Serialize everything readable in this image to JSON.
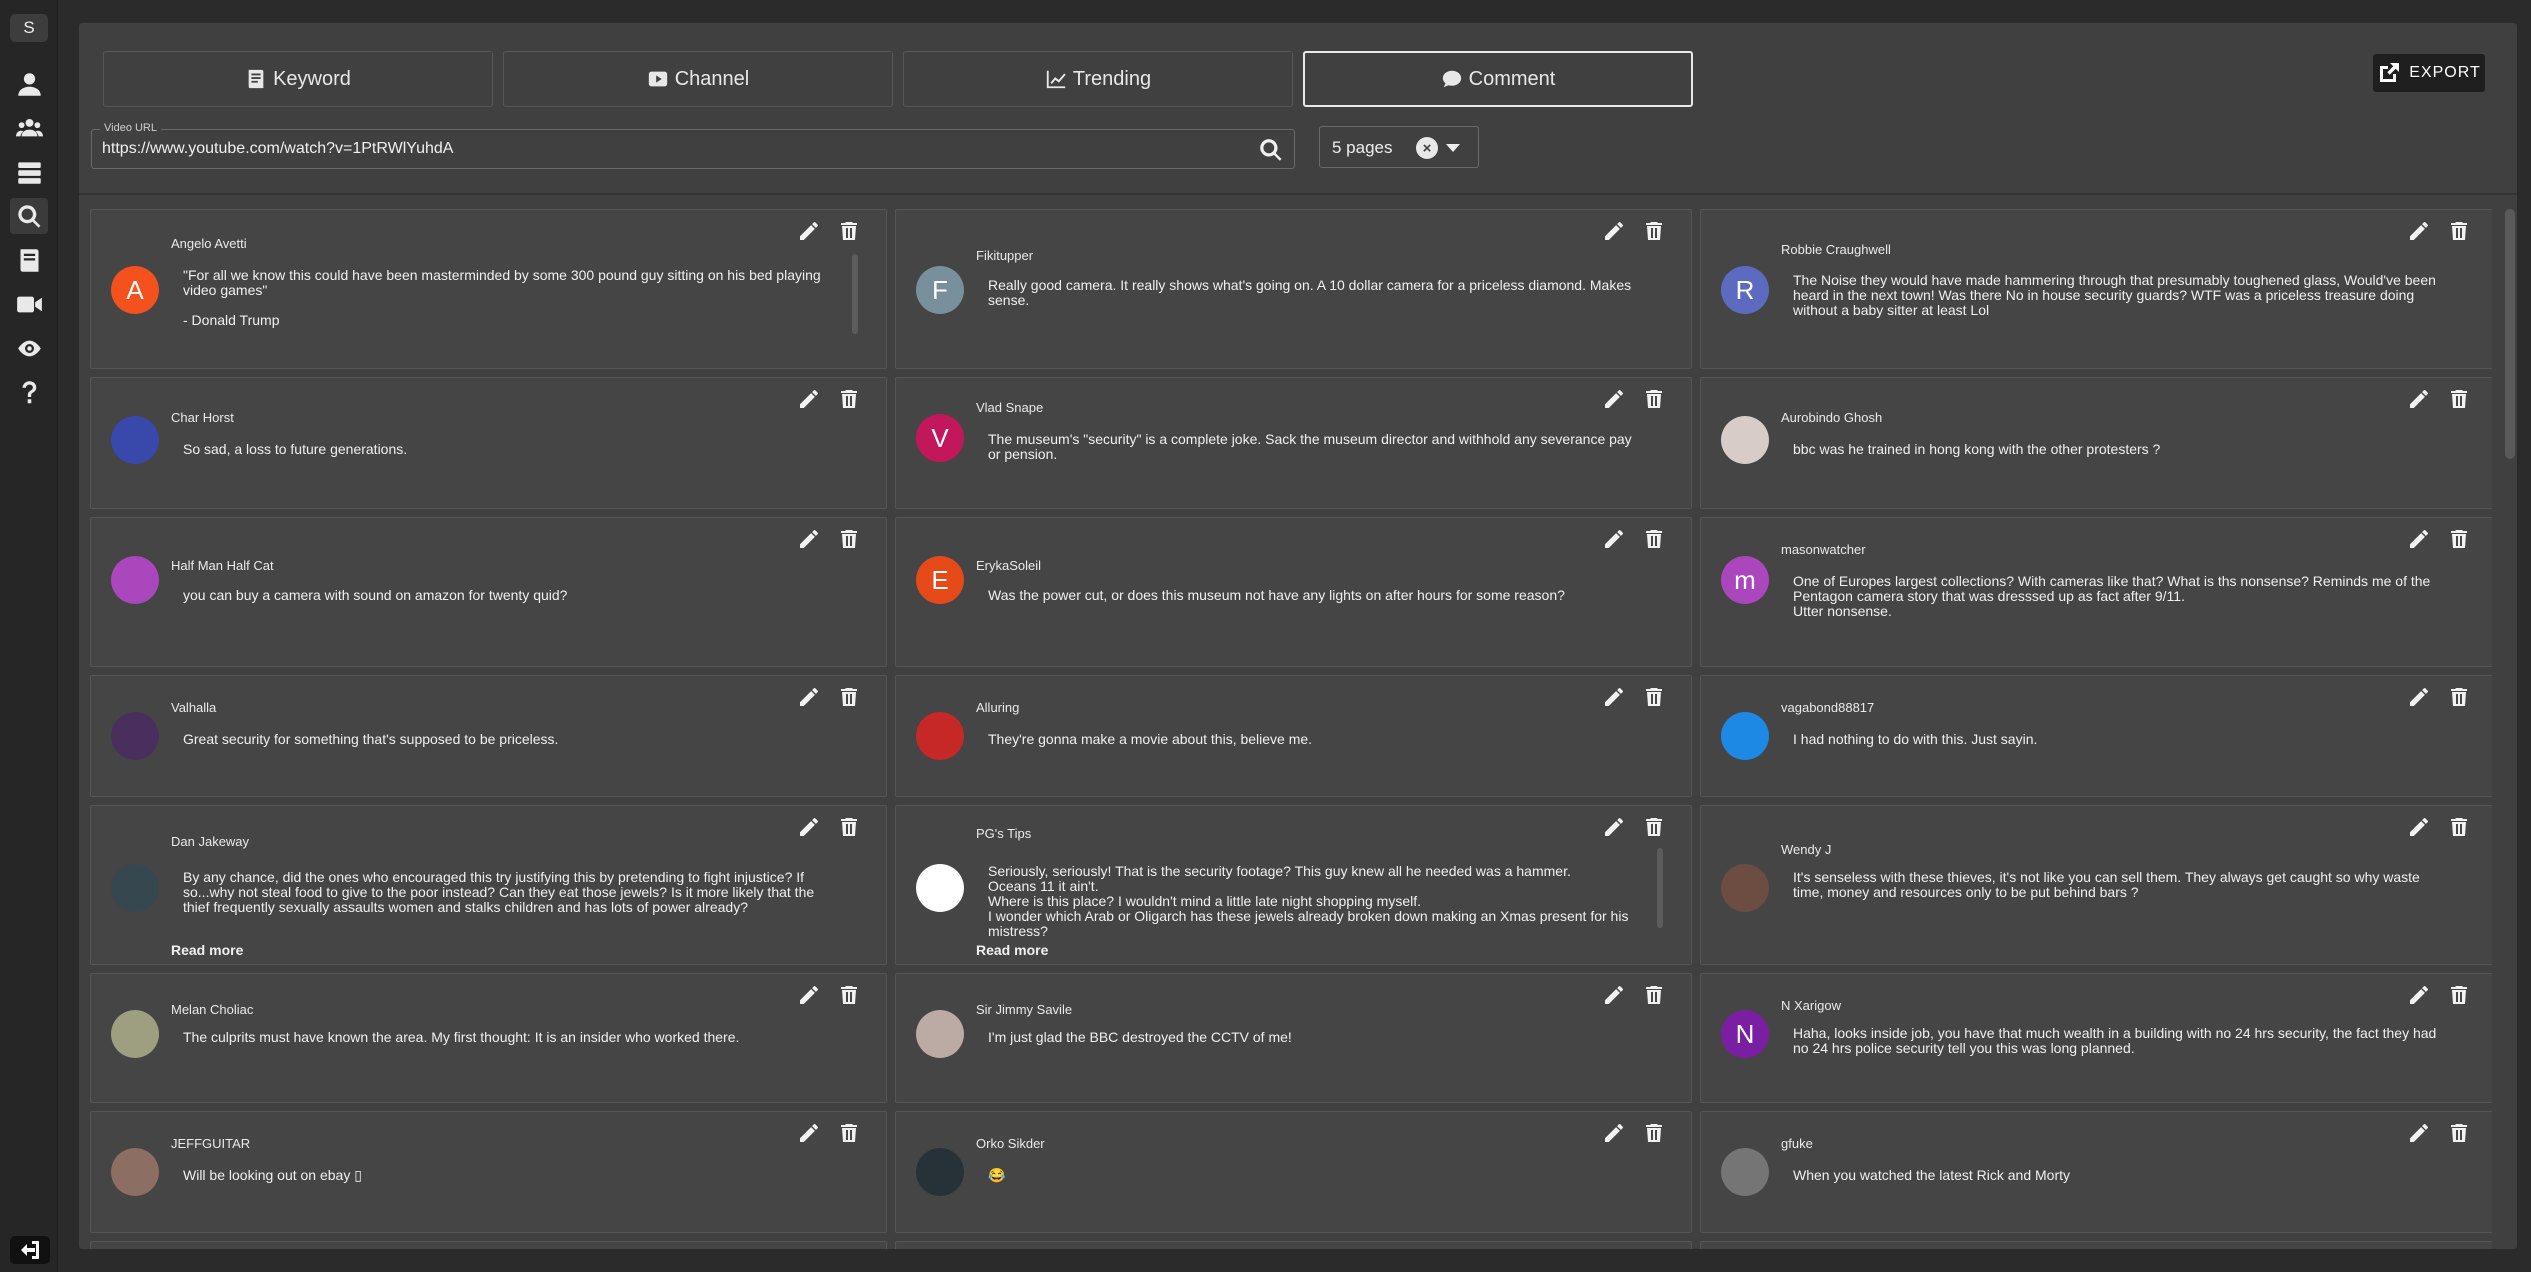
{
  "sidebar": {
    "user_initial": "S",
    "icons": [
      "user-icon",
      "group-icon",
      "list-icon",
      "search-icon",
      "book-icon",
      "video-icon",
      "eye-icon",
      "help-icon"
    ],
    "active": "search-icon",
    "logout_icon": "logout-icon"
  },
  "tabs": [
    {
      "label": "Keyword",
      "icon": "keyword-icon"
    },
    {
      "label": "Channel",
      "icon": "youtube-icon"
    },
    {
      "label": "Trending",
      "icon": "trending-icon"
    },
    {
      "label": "Comment",
      "icon": "comment-icon",
      "active": true
    }
  ],
  "export_label": "EXPORT",
  "search": {
    "label": "Video URL",
    "value": "https://www.youtube.com/watch?v=1PtRWlYuhdA"
  },
  "pages": {
    "value": "5 pages"
  },
  "comments": [
    {
      "author": "Angelo Avetti",
      "avatar": "A",
      "avatar_color": "#f4511e",
      "text": "\"For all we know this could have been masterminded by some 300 pound guy sitting on his bed playing video games\"\n\n- Donald Trump"
    },
    {
      "author": "Fikitupper",
      "avatar": "F",
      "avatar_color": "#78909c",
      "text": "Really good camera. It really shows what's going on. A 10 dollar camera for a priceless diamond. Makes sense."
    },
    {
      "author": "Robbie Craughwell",
      "avatar": "R",
      "avatar_color": "#5c6bc0",
      "text": "The Noise they would have made hammering through that presumably toughened glass, Would've been heard in the next town! Was there No in house security guards? WTF was a priceless treasure doing without a baby sitter at least Lol"
    },
    {
      "author": "Char Horst",
      "avatar": "",
      "avatar_color": "#3949ab",
      "text": "So sad, a loss to future generations."
    },
    {
      "author": "Vlad Snape",
      "avatar": "V",
      "avatar_color": "#c2185b",
      "text": "The museum's \"security\" is a complete joke. Sack the museum director and withhold any severance pay or pension."
    },
    {
      "author": "Aurobindo Ghosh",
      "avatar": "",
      "avatar_color": "#d7ccc8",
      "text": "bbc was he trained in hong kong with the other protesters ?"
    },
    {
      "author": "Half Man Half Cat",
      "avatar": "",
      "avatar_color": "#ab47bc",
      "text": "you can buy a camera with sound on amazon for twenty quid?"
    },
    {
      "author": "ErykaSoleil",
      "avatar": "E",
      "avatar_color": "#e64a19",
      "text": "Was the power cut, or does this museum not have any lights on after hours for some reason?"
    },
    {
      "author": "masonwatcher",
      "avatar": "m",
      "avatar_color": "#ab47bc",
      "text": "One of Europes largest collections? With cameras like that? What is ths nonsense? Reminds me of the Pentagon camera story that was dresssed up as fact after 9/11.\nUtter nonsense."
    },
    {
      "author": "Valhalla",
      "avatar": "",
      "avatar_color": "#4a2f5e",
      "text": "Great security for something that's supposed to be priceless."
    },
    {
      "author": "Alluring",
      "avatar": "",
      "avatar_color": "#c62828",
      "text": "They're gonna make a movie about this, believe me."
    },
    {
      "author": "vagabond88817",
      "avatar": "",
      "avatar_color": "#1e88e5",
      "text": "I had nothing to do with this. Just sayin."
    },
    {
      "author": "Dan Jakeway",
      "avatar": "",
      "avatar_color": "#37474f",
      "text": "By any chance, did the ones who encouraged this try justifying this by pretending to fight injustice? If so...why not steal food to give to the poor instead? Can they eat those jewels? Is it more likely that the thief frequently sexually assaults women and stalks children and has lots of power already?",
      "read_more": "Read more"
    },
    {
      "author": "PG's Tips",
      "avatar": "",
      "avatar_color": "#ffffff",
      "text": "Seriously, seriously! That is the security footage? This guy knew all he needed was a hammer.\nOceans 11 it ain't.\nWhere is this place? I wouldn't mind a little late night shopping myself.\nI wonder which Arab or Oligarch has these jewels already broken down making an Xmas present for his mistress?",
      "read_more": "Read more"
    },
    {
      "author": "Wendy J",
      "avatar": "",
      "avatar_color": "#6d4c41",
      "text": "It's senseless with these thieves, it's not like you can sell them. They always get caught so why waste time, money and resources only to be put behind bars ?"
    },
    {
      "author": "Melan Choliac",
      "avatar": "",
      "avatar_color": "#9e9e80",
      "text": "The culprits must have known the area. My first thought: It is an insider who worked there."
    },
    {
      "author": "Sir Jimmy Savile",
      "avatar": "",
      "avatar_color": "#bcaaa4",
      "text": "I'm just glad the BBC destroyed the CCTV of me!"
    },
    {
      "author": "N Xarigow",
      "avatar": "N",
      "avatar_color": "#7b1fa2",
      "text": "Haha, looks inside job, you have that much wealth in a building with no 24 hrs security, the fact they had no 24 hrs police security tell you this was long planned."
    },
    {
      "author": "JEFFGUITAR",
      "avatar": "",
      "avatar_color": "#8d6e63",
      "text": "Will be looking out on ebay ▯"
    },
    {
      "author": "Orko Sikder",
      "avatar": "",
      "avatar_color": "#263238",
      "text": "😂"
    },
    {
      "author": "gfuke",
      "avatar": "",
      "avatar_color": "#757575",
      "text": "When you watched the latest Rick and Morty"
    }
  ]
}
